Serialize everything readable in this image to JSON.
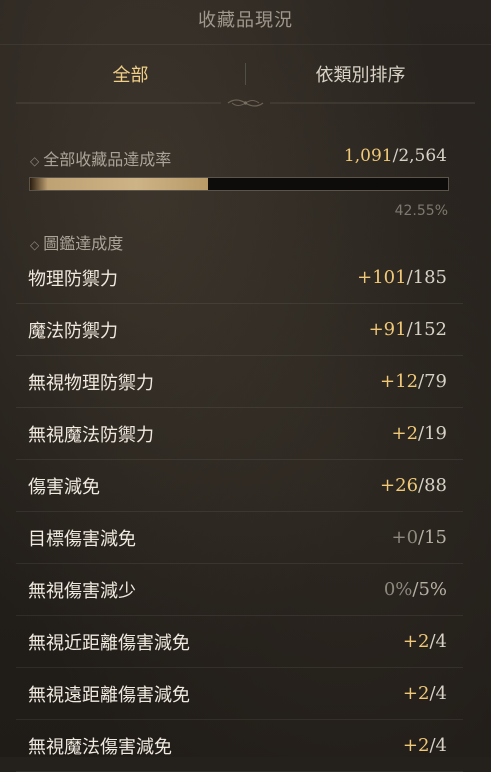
{
  "header": {
    "title": "收藏品現況"
  },
  "tabs": [
    {
      "label": "全部",
      "active": true
    },
    {
      "label": "依類別排序",
      "active": false
    }
  ],
  "completion": {
    "label": "全部收藏品達成率",
    "current": "1,091",
    "separator": "/",
    "total": "2,564",
    "percent_text": "42.55%",
    "progress": 0.4255
  },
  "codex": {
    "label": "圖鑑達成度"
  },
  "stats": [
    {
      "name": "物理防禦力",
      "current": "+101",
      "max": "/185",
      "highlight": true
    },
    {
      "name": "魔法防禦力",
      "current": "+91",
      "max": "/152",
      "highlight": true
    },
    {
      "name": "無視物理防禦力",
      "current": "+12",
      "max": "/79",
      "highlight": true
    },
    {
      "name": "無視魔法防禦力",
      "current": "+2",
      "max": "/19",
      "highlight": true
    },
    {
      "name": "傷害減免",
      "current": "+26",
      "max": "/88",
      "highlight": true
    },
    {
      "name": "目標傷害減免",
      "current": "+0",
      "max": "/15",
      "highlight": false
    },
    {
      "name": "無視傷害減少",
      "current": "0%",
      "max": "/5%",
      "highlight": false
    },
    {
      "name": "無視近距離傷害減免",
      "current": "+2",
      "max": "/4",
      "highlight": true
    },
    {
      "name": "無視遠距離傷害減免",
      "current": "+2",
      "max": "/4",
      "highlight": true
    },
    {
      "name": "無視魔法傷害減免",
      "current": "+2",
      "max": "/4",
      "highlight": true
    }
  ],
  "icons": {
    "bullet": "diamond-icon"
  },
  "colors": {
    "accent": "#f0c878",
    "tab_active": "#f1cf86",
    "muted": "#8e887f"
  }
}
